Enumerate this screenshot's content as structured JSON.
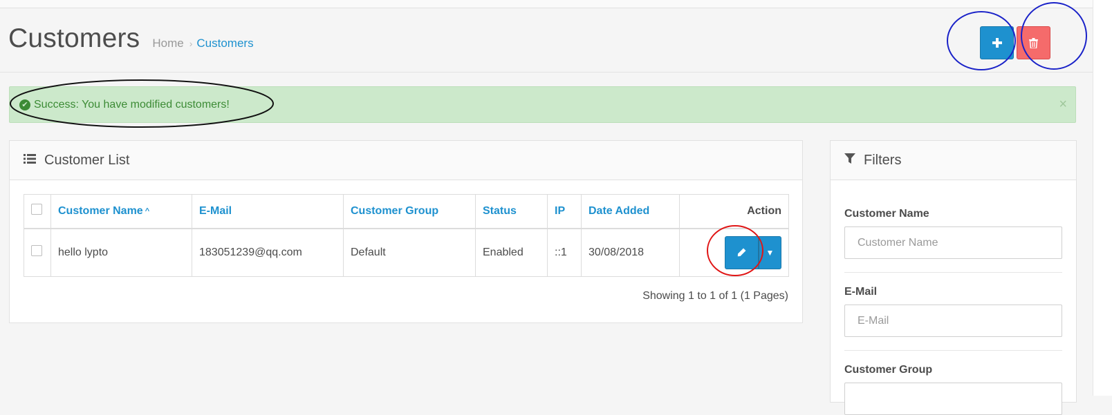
{
  "page": {
    "title": "Customers"
  },
  "breadcrumb": {
    "home": "Home",
    "separator": "›",
    "current": "Customers"
  },
  "toolbar": {
    "add_icon": "plus-icon",
    "delete_icon": "trash-icon"
  },
  "alert": {
    "type": "success",
    "message": "Success: You have modified customers!",
    "close": "×"
  },
  "list_panel": {
    "title": "Customer List",
    "icon": "list-icon",
    "columns": [
      "Customer Name",
      "E-Mail",
      "Customer Group",
      "Status",
      "IP",
      "Date Added",
      "Action"
    ],
    "sort_indicator": "^",
    "rows": [
      {
        "name": "hello lypto",
        "email": "183051239@qq.com",
        "group": "Default",
        "status": "Enabled",
        "ip": "::1",
        "date_added": "30/08/2018"
      }
    ],
    "pagination": "Showing 1 to 1 of 1 (1 Pages)"
  },
  "filter_panel": {
    "title": "Filters",
    "icon": "filter-icon",
    "fields": [
      {
        "label": "Customer Name",
        "placeholder": "Customer Name",
        "value": ""
      },
      {
        "label": "E-Mail",
        "placeholder": "E-Mail",
        "value": ""
      },
      {
        "label": "Customer Group",
        "placeholder": "",
        "value": ""
      }
    ]
  },
  "colors": {
    "primary": "#1e91cf",
    "danger": "#f56b6b",
    "success_bg": "#cce9cb",
    "success_text": "#3c8b35"
  }
}
